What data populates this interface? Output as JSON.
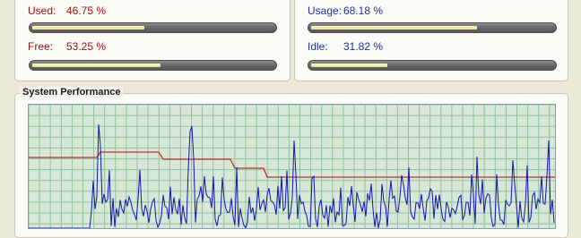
{
  "memory": {
    "used": {
      "label": "Used:",
      "value": "46.75 %",
      "fraction": 0.4675
    },
    "free": {
      "label": "Free:",
      "value": "53.25 %",
      "fraction": 0.5325
    }
  },
  "cpu": {
    "usage": {
      "label": "Usage:",
      "value": "68.18 %",
      "fraction": 0.6818
    },
    "idle": {
      "label": "Idle:",
      "value": "31.82 %",
      "fraction": 0.3182
    }
  },
  "performance": {
    "title": "System Performance"
  },
  "colors": {
    "memory_label": "#a01010",
    "cpu_label": "#1c2fa0",
    "grid_line": "#8fc29a",
    "memory_line": "#c03030",
    "cpu_line": "#1414b8"
  }
}
